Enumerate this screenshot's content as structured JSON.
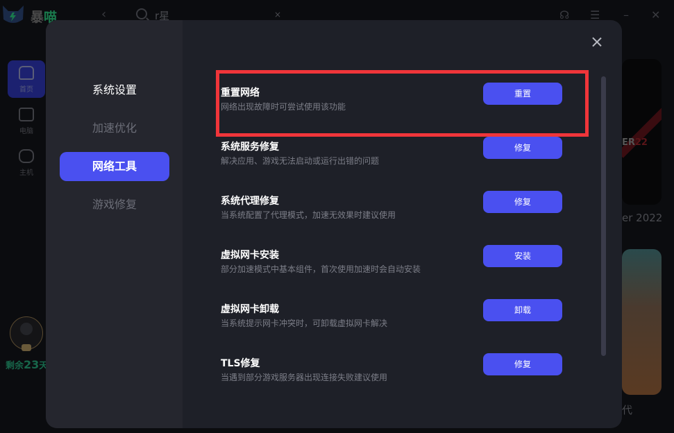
{
  "app": {
    "brand_prefix": "暴",
    "brand_suffix": "喵",
    "back_icon": "chevron-left-icon",
    "search": {
      "value": "r星",
      "clear": "×"
    },
    "window_icons": [
      "headset-icon",
      "list-icon",
      "minimize-icon",
      "close-icon"
    ],
    "nav": [
      {
        "label": "首页",
        "icon": "home-icon"
      },
      {
        "label": "电脑",
        "icon": "monitor-icon"
      },
      {
        "label": "主机",
        "icon": "gamepad-icon"
      }
    ],
    "remaining_prefix": "剩余",
    "remaining_days": "23",
    "remaining_suffix": "天",
    "bg_card1_text": "ER",
    "bg_card1_num": "22",
    "bg_caption1": "er 2022",
    "bg_caption2": "代"
  },
  "modal": {
    "close_label": "close",
    "tabs": [
      {
        "label": "系统设置"
      },
      {
        "label": "加速优化"
      },
      {
        "label": "网络工具",
        "active": true
      },
      {
        "label": "游戏修复"
      }
    ],
    "items": [
      {
        "title": "重置网络",
        "desc": "网络出现故障时可尝试使用该功能",
        "button": "重置"
      },
      {
        "title": "系统服务修复",
        "desc": "解决应用、游戏无法启动或运行出错的问题",
        "button": "修复"
      },
      {
        "title": "系统代理修复",
        "desc": "当系统配置了代理模式，加速无效果时建议使用",
        "button": "修复"
      },
      {
        "title": "虚拟网卡安装",
        "desc": "部分加速模式中基本组件，首次使用加速时会自动安装",
        "button": "安装"
      },
      {
        "title": "虚拟网卡卸载",
        "desc": "当系统提示网卡冲突时，可卸载虚拟网卡解决",
        "button": "卸载"
      },
      {
        "title": "TLS修复",
        "desc": "当遇到部分游戏服务器出现连接失败建议使用",
        "button": "修复"
      }
    ]
  },
  "colors": {
    "accent": "#4a50f0",
    "highlight": "#f0353a",
    "modal_bg": "#1e2028",
    "modal_side": "#25262e"
  }
}
